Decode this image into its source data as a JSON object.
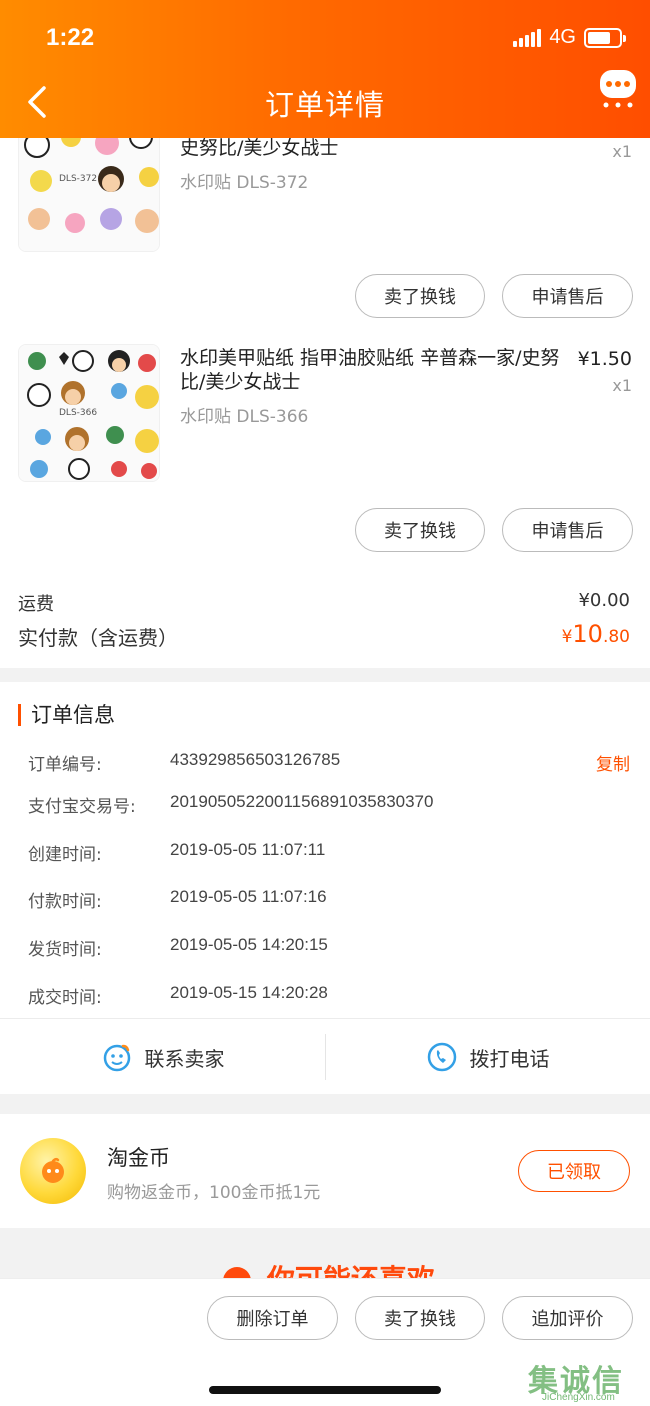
{
  "status_bar": {
    "time": "1:22",
    "network": "4G"
  },
  "header": {
    "title": "订单详情"
  },
  "products": [
    {
      "title": "史努比/美少女战士",
      "spec": "水印贴 DLS-372",
      "qty": "x1",
      "thumb_label": "DLS-372",
      "buttons": [
        "卖了换钱",
        "申请售后"
      ]
    },
    {
      "title": "水印美甲贴纸 指甲油胶贴纸 辛普森一家/史努比/美少女战士",
      "spec": "水印贴 DLS-366",
      "price": "¥1.50",
      "qty": "x1",
      "thumb_label": "DLS-366",
      "buttons": [
        "卖了换钱",
        "申请售后"
      ]
    }
  ],
  "summary": {
    "shipping_label": "运费",
    "shipping_value": "¥0.00",
    "total_label": "实付款（含运费）",
    "total_currency": "¥",
    "total_int": "10",
    "total_dec": ".80"
  },
  "order_info": {
    "title": "订单信息",
    "copy_label": "复制",
    "rows": [
      {
        "label": "订单编号:",
        "value": "433929856503126785"
      },
      {
        "label": "支付宝交易号:",
        "value": "2019050522001156891035830370"
      },
      {
        "label": "创建时间:",
        "value": "2019-05-05 11:07:11"
      },
      {
        "label": "付款时间:",
        "value": "2019-05-05 11:07:16"
      },
      {
        "label": "发货时间:",
        "value": "2019-05-05 14:20:15"
      },
      {
        "label": "成交时间:",
        "value": "2019-05-15 14:20:28"
      }
    ]
  },
  "contact": {
    "seller_label": "联系卖家",
    "phone_label": "拨打电话"
  },
  "coins": {
    "title": "淘金币",
    "subtitle": "购物返金币，100金币抵1元",
    "button_label": "已领取"
  },
  "recommend": {
    "text": "你可能还喜欢"
  },
  "bottom_bar": {
    "buttons": [
      "删除订单",
      "卖了换钱",
      "追加评价"
    ]
  },
  "watermark": {
    "main": "集诚信",
    "sub": "JiChengXin.com"
  },
  "colors": {
    "accent": "#ff5000",
    "header_start": "#ff8c00",
    "header_end": "#ff4e00"
  }
}
